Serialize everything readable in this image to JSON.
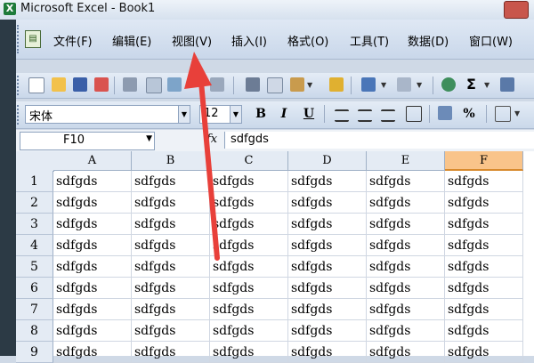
{
  "window": {
    "title": "Microsoft Excel - Book1",
    "app_icon": "X"
  },
  "menu": {
    "doc_icon": "doc-icon",
    "items": [
      "文件(F)",
      "编辑(E)",
      "视图(V)",
      "插入(I)",
      "格式(O)",
      "工具(T)",
      "数据(D)",
      "窗口(W)"
    ]
  },
  "toolbar": {
    "icons": [
      "new-icon",
      "open-icon",
      "save-icon",
      "permission-icon",
      "print-icon",
      "print-preview-icon",
      "spellcheck-icon",
      "research-icon",
      "cut-icon",
      "copy-icon",
      "paste-icon",
      "format-painter-icon",
      "undo-icon",
      "redo-icon",
      "hyperlink-icon",
      "autosum-icon",
      "sort-ascending-icon"
    ],
    "autosum_label": "Σ"
  },
  "format": {
    "font": "宋体",
    "size": "12",
    "bold": "B",
    "italic": "I",
    "underline": "U",
    "percent": "%"
  },
  "formula_bar": {
    "name_box": "F10",
    "fx": "fx",
    "value": "sdfgds"
  },
  "sheet": {
    "columns": [
      "A",
      "B",
      "C",
      "D",
      "E",
      "F"
    ],
    "active_column": "F",
    "rows": [
      {
        "n": "1",
        "cells": [
          "sdfgds",
          "sdfgds",
          "sdfgds",
          "sdfgds",
          "sdfgds",
          "sdfgds"
        ]
      },
      {
        "n": "2",
        "cells": [
          "sdfgds",
          "sdfgds",
          "sdfgds",
          "sdfgds",
          "sdfgds",
          "sdfgds"
        ]
      },
      {
        "n": "3",
        "cells": [
          "sdfgds",
          "sdfgds",
          "sdfgds",
          "sdfgds",
          "sdfgds",
          "sdfgds"
        ]
      },
      {
        "n": "4",
        "cells": [
          "sdfgds",
          "sdfgds",
          "sdfgds",
          "sdfgds",
          "sdfgds",
          "sdfgds"
        ]
      },
      {
        "n": "5",
        "cells": [
          "sdfgds",
          "sdfgds",
          "sdfgds",
          "sdfgds",
          "sdfgds",
          "sdfgds"
        ]
      },
      {
        "n": "6",
        "cells": [
          "sdfgds",
          "sdfgds",
          "sdfgds",
          "sdfgds",
          "sdfgds",
          "sdfgds"
        ]
      },
      {
        "n": "7",
        "cells": [
          "sdfgds",
          "sdfgds",
          "sdfgds",
          "sdfgds",
          "sdfgds",
          "sdfgds"
        ]
      },
      {
        "n": "8",
        "cells": [
          "sdfgds",
          "sdfgds",
          "sdfgds",
          "sdfgds",
          "sdfgds",
          "sdfgds"
        ]
      },
      {
        "n": "9",
        "cells": [
          "sdfgds",
          "sdfgds",
          "sdfgds",
          "sdfgds",
          "sdfgds",
          "sdfgds"
        ]
      }
    ]
  },
  "colors": {
    "accent_arrow": "#e8403a",
    "active_header": "#f9c48a"
  }
}
